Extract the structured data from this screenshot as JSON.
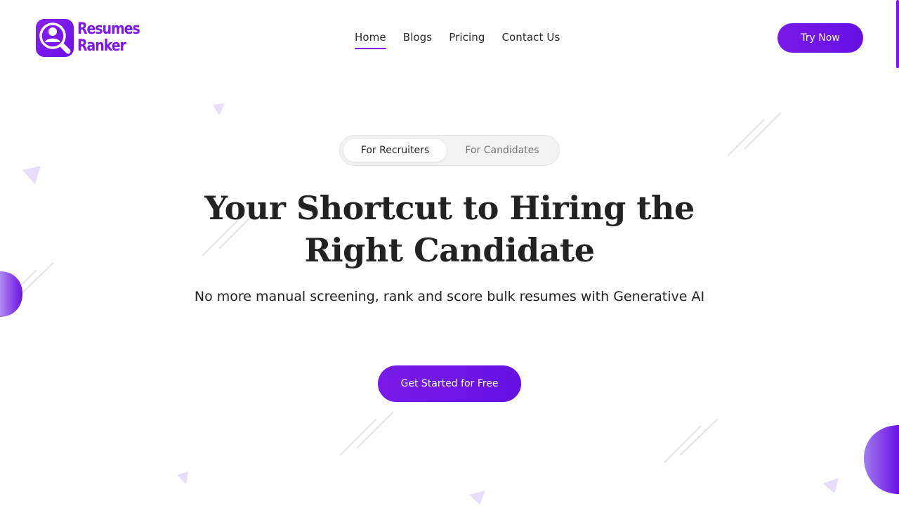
{
  "brand": {
    "line1": "Resumes",
    "line2": "Ranker",
    "color": "#7a1ae8"
  },
  "nav": {
    "items": [
      {
        "label": "Home",
        "active": true
      },
      {
        "label": "Blogs",
        "active": false
      },
      {
        "label": "Pricing",
        "active": false
      },
      {
        "label": "Contact Us",
        "active": false
      }
    ]
  },
  "header": {
    "try_label": "Try Now"
  },
  "audience_toggle": {
    "options": [
      "For Recruiters",
      "For Candidates"
    ],
    "selected": "For Recruiters"
  },
  "hero": {
    "title_line1": "Your Shortcut to Hiring the",
    "title_line2": "Right Candidate",
    "subtitle": "No more manual screening, rank and score bulk resumes with Generative AI",
    "cta_label": "Get Started for Free"
  },
  "icons": {
    "logo": "user-search-icon"
  },
  "colors": {
    "accent": "#7a1ae8",
    "accent_dark": "#6510e4",
    "decor_light": "#e6defc"
  }
}
